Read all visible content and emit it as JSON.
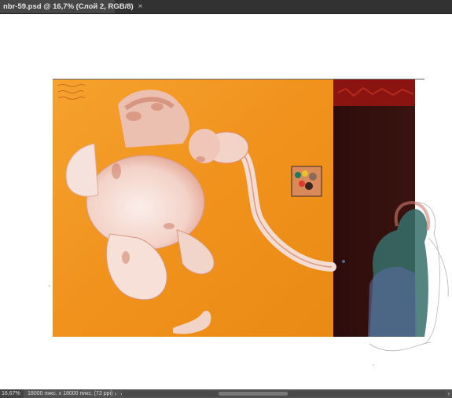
{
  "document_tab": {
    "title": "nbr-59.psd @ 16,7% (Слой 2, RGB/8)",
    "close_glyph": "×"
  },
  "canvas": {
    "background": "#ffffff",
    "artwork": {
      "background_color": "#f0921c",
      "dark_panel_color": "#2e0f0d",
      "red_band_color": "#8a1410",
      "subject": "painting of a pale pink elephant on orange ground with a dark red panel and a sketched figure"
    }
  },
  "status_bar": {
    "zoom": "16,67%",
    "doc_info": "18000 пикс. x 18000 пикс. (72 ppi)",
    "expand_glyph": "›",
    "scroll_left_glyph": "‹",
    "scroll_right_glyph": "›"
  }
}
